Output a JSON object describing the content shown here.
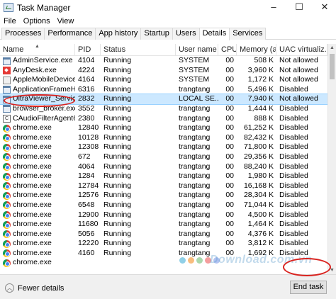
{
  "window": {
    "title": "Task Manager",
    "minimize": "–",
    "maximize": "☐",
    "close": "✕"
  },
  "menu": [
    "File",
    "Options",
    "View"
  ],
  "tabs": [
    "Processes",
    "Performance",
    "App history",
    "Startup",
    "Users",
    "Details",
    "Services"
  ],
  "active_tab": "Details",
  "columns": {
    "name": "Name",
    "pid": "PID",
    "status": "Status",
    "user": "User name",
    "cpu": "CPU",
    "mem": "Memory (a...",
    "uac": "UAC virtualiz..."
  },
  "rows": [
    {
      "name": "AdminService.exe",
      "pid": "4104",
      "status": "Running",
      "user": "SYSTEM",
      "cpu": "00",
      "mem": "508 K",
      "uac": "Not allowed",
      "icon": "generic-app-icon"
    },
    {
      "name": "AnyDesk.exe",
      "pid": "4224",
      "status": "Running",
      "user": "SYSTEM",
      "cpu": "00",
      "mem": "3,960 K",
      "uac": "Not allowed",
      "icon": "anydesk-icon"
    },
    {
      "name": "AppleMobileDeviceS...",
      "pid": "4164",
      "status": "Running",
      "user": "SYSTEM",
      "cpu": "00",
      "mem": "1,172 K",
      "uac": "Not allowed",
      "icon": "apple-icon"
    },
    {
      "name": "ApplicationFrameHo...",
      "pid": "6316",
      "status": "Running",
      "user": "trangtang",
      "cpu": "00",
      "mem": "5,496 K",
      "uac": "Disabled",
      "icon": "generic-app-icon"
    },
    {
      "name": "UltraViewer_Service.ex...",
      "pid": "2832",
      "status": "Running",
      "user": "LOCAL SE...",
      "cpu": "00",
      "mem": "7,940 K",
      "uac": "Not allowed",
      "icon": "generic-app-icon"
    },
    {
      "name": "browser_broker.exe",
      "pid": "3552",
      "status": "Running",
      "user": "trangtang",
      "cpu": "00",
      "mem": "1,444 K",
      "uac": "Disabled",
      "icon": "generic-app-icon"
    },
    {
      "name": "CAudioFilterAgent64...",
      "pid": "2380",
      "status": "Running",
      "user": "trangtang",
      "cpu": "00",
      "mem": "888 K",
      "uac": "Disabled",
      "icon": "cpp-icon"
    },
    {
      "name": "chrome.exe",
      "pid": "12840",
      "status": "Running",
      "user": "trangtang",
      "cpu": "00",
      "mem": "61,252 K",
      "uac": "Disabled",
      "icon": "chrome-icon"
    },
    {
      "name": "chrome.exe",
      "pid": "10128",
      "status": "Running",
      "user": "trangtang",
      "cpu": "00",
      "mem": "82,432 K",
      "uac": "Disabled",
      "icon": "chrome-icon"
    },
    {
      "name": "chrome.exe",
      "pid": "12308",
      "status": "Running",
      "user": "trangtang",
      "cpu": "00",
      "mem": "71,800 K",
      "uac": "Disabled",
      "icon": "chrome-icon"
    },
    {
      "name": "chrome.exe",
      "pid": "672",
      "status": "Running",
      "user": "trangtang",
      "cpu": "00",
      "mem": "29,356 K",
      "uac": "Disabled",
      "icon": "chrome-icon"
    },
    {
      "name": "chrome.exe",
      "pid": "4064",
      "status": "Running",
      "user": "trangtang",
      "cpu": "00",
      "mem": "88,240 K",
      "uac": "Disabled",
      "icon": "chrome-icon"
    },
    {
      "name": "chrome.exe",
      "pid": "1284",
      "status": "Running",
      "user": "trangtang",
      "cpu": "00",
      "mem": "1,980 K",
      "uac": "Disabled",
      "icon": "chrome-icon"
    },
    {
      "name": "chrome.exe",
      "pid": "12784",
      "status": "Running",
      "user": "trangtang",
      "cpu": "00",
      "mem": "16,168 K",
      "uac": "Disabled",
      "icon": "chrome-icon"
    },
    {
      "name": "chrome.exe",
      "pid": "12576",
      "status": "Running",
      "user": "trangtang",
      "cpu": "00",
      "mem": "28,304 K",
      "uac": "Disabled",
      "icon": "chrome-icon"
    },
    {
      "name": "chrome.exe",
      "pid": "6548",
      "status": "Running",
      "user": "trangtang",
      "cpu": "00",
      "mem": "71,044 K",
      "uac": "Disabled",
      "icon": "chrome-icon"
    },
    {
      "name": "chrome.exe",
      "pid": "12900",
      "status": "Running",
      "user": "trangtang",
      "cpu": "00",
      "mem": "4,500 K",
      "uac": "Disabled",
      "icon": "chrome-icon"
    },
    {
      "name": "chrome.exe",
      "pid": "11680",
      "status": "Running",
      "user": "trangtang",
      "cpu": "00",
      "mem": "1,464 K",
      "uac": "Disabled",
      "icon": "chrome-icon"
    },
    {
      "name": "chrome.exe",
      "pid": "5056",
      "status": "Running",
      "user": "trangtang",
      "cpu": "00",
      "mem": "4,376 K",
      "uac": "Disabled",
      "icon": "chrome-icon"
    },
    {
      "name": "chrome.exe",
      "pid": "12220",
      "status": "Running",
      "user": "trangtang",
      "cpu": "00",
      "mem": "3,812 K",
      "uac": "Disabled",
      "icon": "chrome-icon"
    },
    {
      "name": "chrome.exe",
      "pid": "4160",
      "status": "Running",
      "user": "trangtang",
      "cpu": "00",
      "mem": "1,692 K",
      "uac": "Disabled",
      "icon": "chrome-icon"
    },
    {
      "name": "chrome.exe",
      "pid": "",
      "status": "",
      "user": "",
      "cpu": "",
      "mem": "",
      "uac": "",
      "icon": "chrome-icon"
    }
  ],
  "selected_row_index": 4,
  "footer": {
    "fewer_details": "Fewer details",
    "end_task": "End task"
  },
  "watermark": "Download.com.vn",
  "watermark_dot_colors": [
    "#7ec8e3",
    "#f7b267",
    "#9bd19e",
    "#f28c8c",
    "#a6b8f0"
  ]
}
